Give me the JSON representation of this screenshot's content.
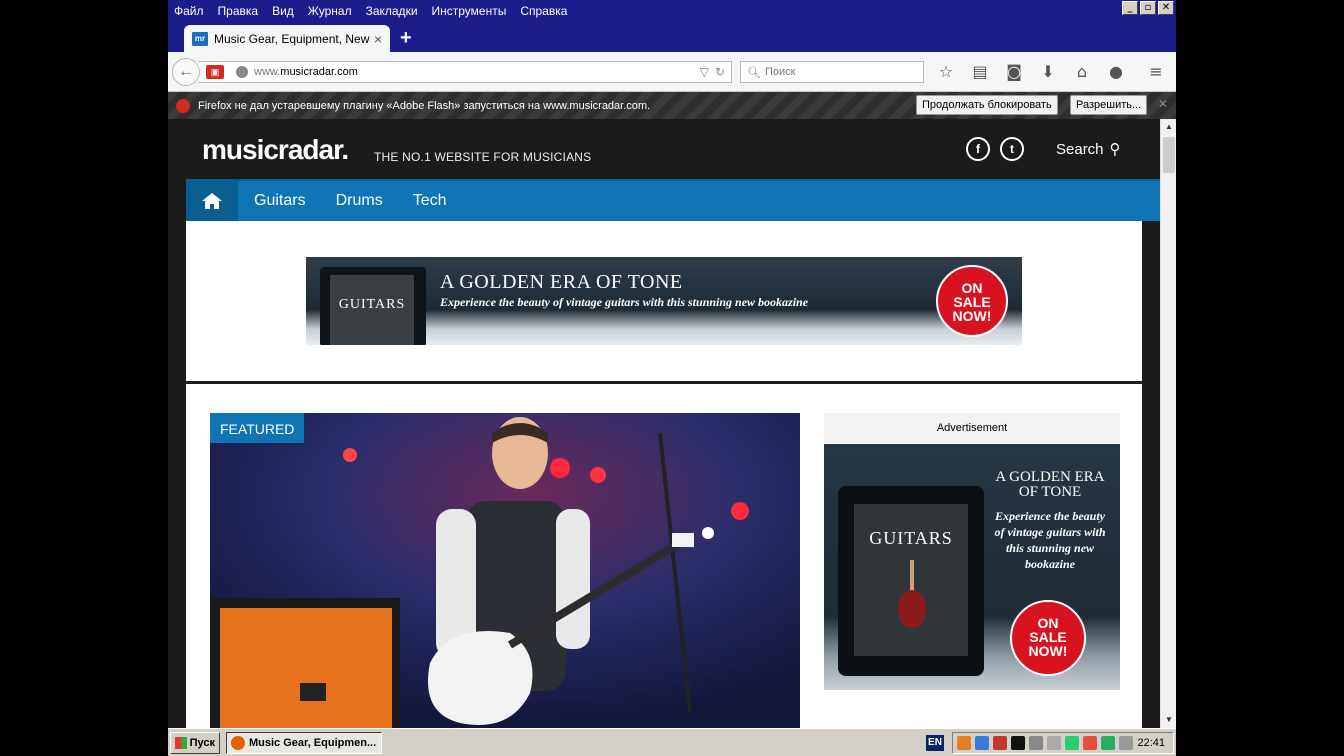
{
  "menubar": {
    "items": [
      "Файл",
      "Правка",
      "Вид",
      "Журнал",
      "Закладки",
      "Инструменты",
      "Справка"
    ]
  },
  "tab": {
    "title": "Music Gear, Equipment, News...",
    "favicon_text": "mr"
  },
  "urlbar": {
    "url_prefix": "www.",
    "url_domain": "musicradar.com"
  },
  "searchbar": {
    "placeholder": "Поиск"
  },
  "notice": {
    "text": "Firefox не дал устаревшему плагину «Adobe Flash» запуститься на www.musicradar.com.",
    "continue_blocking": "Продолжать блокировать",
    "allow": "Разрешить..."
  },
  "site": {
    "logo": "musicradar.",
    "tagline": "THE NO.1 WEBSITE FOR MUSICIANS",
    "search_label": "Search",
    "nav": [
      "Guitars",
      "Drums",
      "Tech"
    ]
  },
  "top_ad": {
    "headline": "A GOLDEN ERA OF TONE",
    "sub": "Experience the beauty of vintage guitars with this stunning new bookazine",
    "cover": "GUITARS",
    "sale": [
      "ON",
      "SALE",
      "NOW!"
    ]
  },
  "featured": {
    "badge": "FEATURED"
  },
  "side_ad": {
    "label": "Advertisement",
    "title": "A GOLDEN ERA OF TONE",
    "desc": "Experience the beauty of vintage guitars with this stunning new bookazine",
    "cover": "GUITARS",
    "sale": [
      "ON",
      "SALE",
      "NOW!"
    ]
  },
  "taskbar": {
    "start": "Пуск",
    "window": "Music Gear, Equipmen...",
    "lang": "EN",
    "clock": "22:41"
  },
  "colors": {
    "site_blue": "#0e74b4",
    "sale_red": "#d8131f",
    "titlebar": "#1c1c8a"
  }
}
